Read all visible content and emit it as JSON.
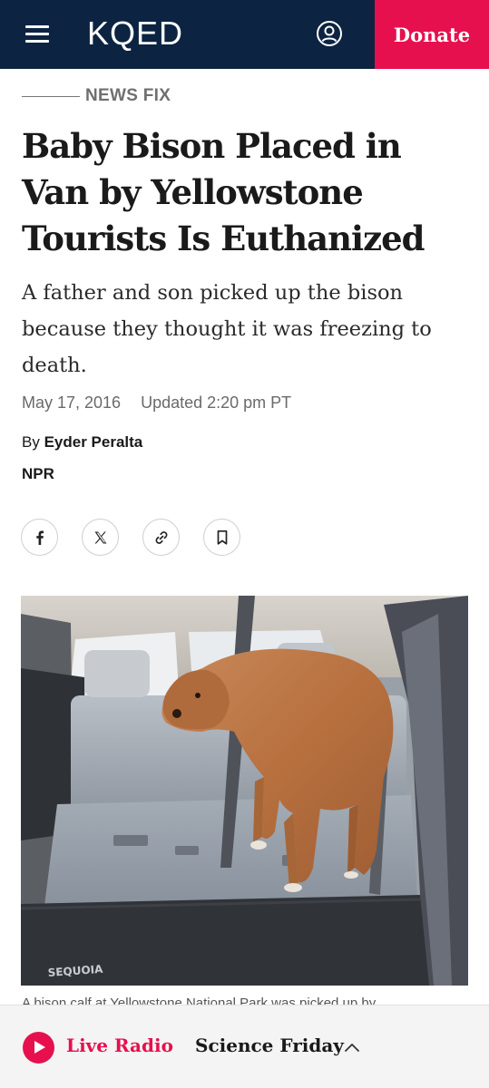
{
  "header": {
    "logo": "KQED",
    "donate_label": "Donate"
  },
  "article": {
    "category": "NEWS FIX",
    "headline": "Baby Bison Placed in Van by Yellowstone Tourists Is Euthanized",
    "dek": "A father and son picked up the bison because they thought it was freezing to death.",
    "date": "May 17, 2016",
    "updated": "Updated 2:20 pm PT",
    "byline_prefix": "By",
    "author": "Eyder Peralta",
    "source": "NPR",
    "caption": "A bison calf at Yellowstone National Park was picked up by"
  },
  "photo": {
    "mat_text": "SEQUOIA"
  },
  "player": {
    "live_label": "Live Radio",
    "program": "Science Friday"
  },
  "colors": {
    "header_bg": "#0c2441",
    "accent": "#e6104e"
  },
  "icons": [
    "menu-icon",
    "account-icon",
    "facebook-icon",
    "x-icon",
    "link-icon",
    "bookmark-icon",
    "play-icon",
    "chevron-up-icon"
  ]
}
